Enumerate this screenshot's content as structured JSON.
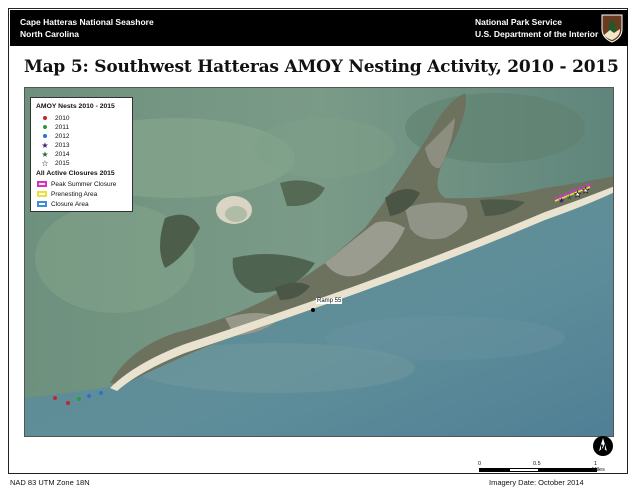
{
  "banner": {
    "left_line1": "Cape Hatteras National Seashore",
    "left_line2": "North Carolina",
    "right_line1": "National Park Service",
    "right_line2": "U.S. Department of the Interior"
  },
  "title": "Map 5:  Southwest Hatteras AMOY Nesting Activity, 2010 - 2015",
  "legend": {
    "nests_heading": "AMOY Nests 2010 - 2015",
    "nests": [
      {
        "label": "2010",
        "symbol": "dot",
        "color": "#c0272d"
      },
      {
        "label": "2011",
        "symbol": "dot",
        "color": "#2e9a3c"
      },
      {
        "label": "2012",
        "symbol": "dot",
        "color": "#2f6fd0"
      },
      {
        "label": "2013",
        "symbol": "star",
        "color": "#3a1e78"
      },
      {
        "label": "2014",
        "symbol": "star",
        "color": "#2c6b35"
      },
      {
        "label": "2015",
        "symbol": "star",
        "color": "#ffffff"
      }
    ],
    "closures_heading": "All Active Closures 2015",
    "closures": [
      {
        "label": "Peak Summer Closure",
        "border_color": "#d42fd4",
        "style": "dashed"
      },
      {
        "label": "Prenesting Area",
        "border_color": "#e8e23a",
        "style": "solid"
      },
      {
        "label": "Closure Area",
        "border_color": "#3a8fd6",
        "style": "solid"
      }
    ]
  },
  "map_labels": {
    "ramp": "Ramp 55"
  },
  "scale": {
    "ticks": [
      "0",
      "0.5",
      "1"
    ],
    "unit": "Miles"
  },
  "footer": {
    "left": "NAD 83 UTM Zone 18N",
    "right": "Imagery Date:  October 2014"
  }
}
